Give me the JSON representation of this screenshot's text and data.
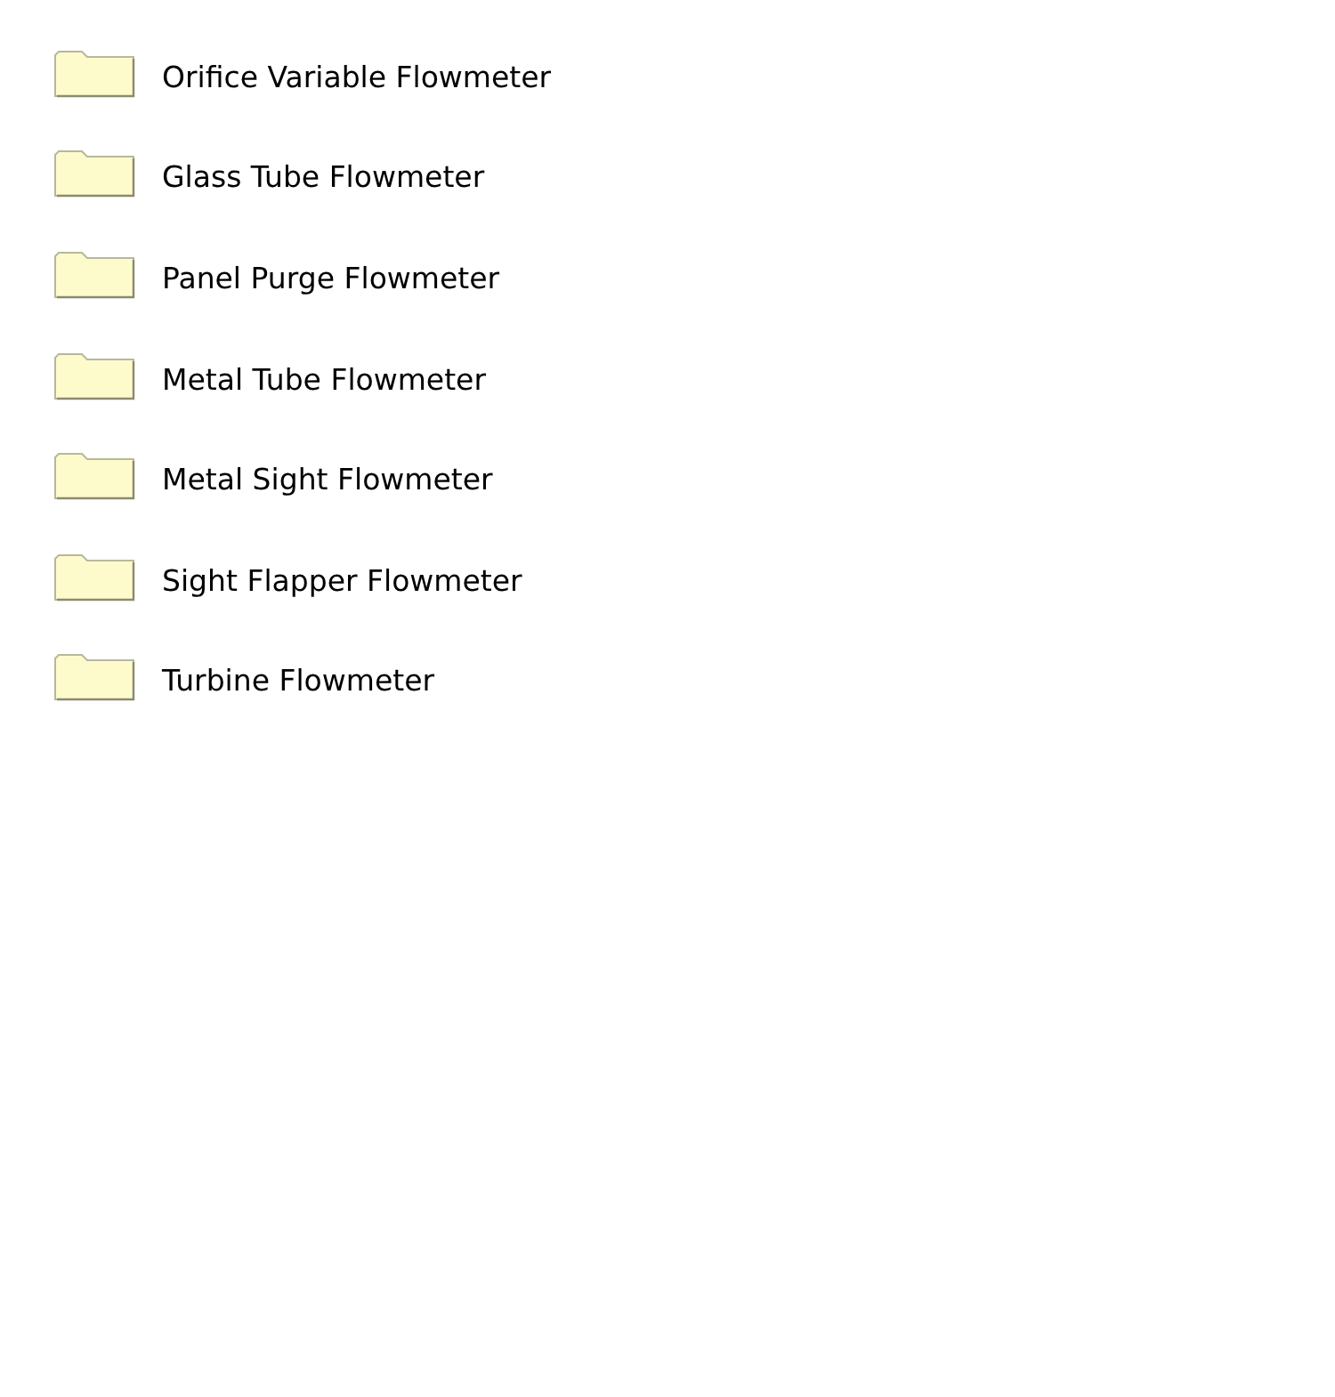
{
  "folders": [
    {
      "label": "Orifice Variable Flowmeter"
    },
    {
      "label": "Glass Tube Flowmeter"
    },
    {
      "label": "Panel Purge Flowmeter"
    },
    {
      "label": "Metal Tube Flowmeter"
    },
    {
      "label": "Metal Sight Flowmeter"
    },
    {
      "label": "Sight Flapper Flowmeter"
    },
    {
      "label": "Turbine Flowmeter"
    }
  ]
}
